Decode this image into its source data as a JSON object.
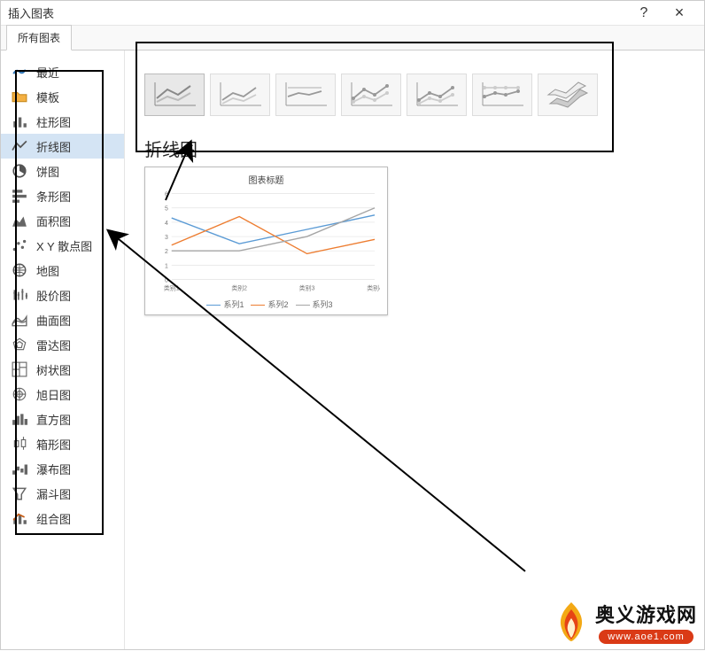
{
  "dialog": {
    "title": "插入图表",
    "help": "?",
    "close": "×"
  },
  "tabs": {
    "all": "所有图表"
  },
  "sidebar": {
    "items": [
      {
        "label": "最近"
      },
      {
        "label": "模板"
      },
      {
        "label": "柱形图"
      },
      {
        "label": "折线图"
      },
      {
        "label": "饼图"
      },
      {
        "label": "条形图"
      },
      {
        "label": "面积图"
      },
      {
        "label": "X Y 散点图"
      },
      {
        "label": "地图"
      },
      {
        "label": "股价图"
      },
      {
        "label": "曲面图"
      },
      {
        "label": "雷达图"
      },
      {
        "label": "树状图"
      },
      {
        "label": "旭日图"
      },
      {
        "label": "直方图"
      },
      {
        "label": "箱形图"
      },
      {
        "label": "瀑布图"
      },
      {
        "label": "漏斗图"
      },
      {
        "label": "组合图"
      }
    ]
  },
  "subtype_title": "折线图",
  "chart_data": {
    "type": "line",
    "title": "图表标题",
    "categories": [
      "类别1",
      "类别2",
      "类别3",
      "类别4"
    ],
    "series": [
      {
        "name": "系列1",
        "values": [
          4.3,
          2.5,
          3.5,
          4.5
        ],
        "color": "#5b9bd5"
      },
      {
        "name": "系列2",
        "values": [
          2.4,
          4.4,
          1.8,
          2.8
        ],
        "color": "#ed7d31"
      },
      {
        "name": "系列3",
        "values": [
          2.0,
          2.0,
          3.0,
          5.0
        ],
        "color": "#a5a5a5"
      }
    ],
    "ylim": [
      0,
      6
    ],
    "yticks": [
      0,
      1,
      2,
      3,
      4,
      5,
      6
    ]
  },
  "watermark": {
    "cn": "奥义游戏网",
    "url": "www.aoe1.com"
  }
}
